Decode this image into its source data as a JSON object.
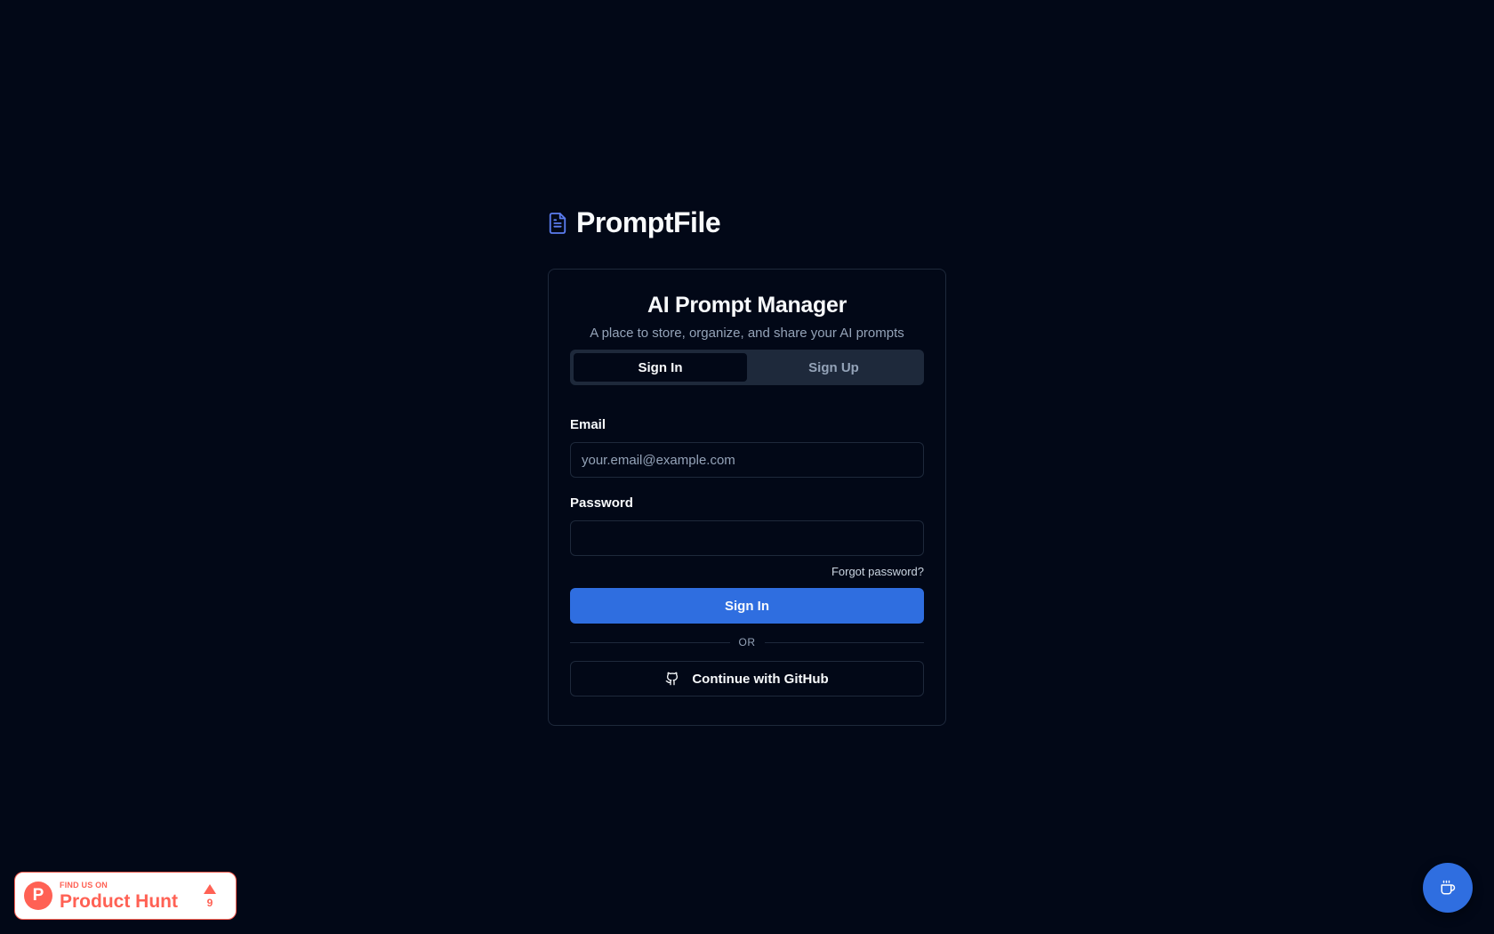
{
  "brand": {
    "name": "PromptFile",
    "icon": "file-text-icon",
    "accent": "#5b7cf0"
  },
  "card": {
    "title": "AI Prompt Manager",
    "subtitle": "A place to store, organize, and share your AI prompts",
    "tabs": [
      {
        "label": "Sign In",
        "active": true
      },
      {
        "label": "Sign Up",
        "active": false
      }
    ]
  },
  "form": {
    "email_label": "Email",
    "email_placeholder": "your.email@example.com",
    "email_value": "",
    "password_label": "Password",
    "password_value": "",
    "forgot_label": "Forgot password?",
    "submit_label": "Sign In",
    "divider_label": "OR",
    "github_label": "Continue with GitHub",
    "github_icon": "github-icon"
  },
  "product_hunt": {
    "small_text": "FIND US ON",
    "big_text": "Product Hunt",
    "logo_letter": "P",
    "votes": "9",
    "color": "#ff6154"
  },
  "floating": {
    "icon": "coffee-icon",
    "color": "#2f6ee0"
  },
  "colors": {
    "background": "#020817",
    "primary": "#2f6ee0",
    "border": "#1e293b",
    "muted_text": "#94a3b8"
  }
}
